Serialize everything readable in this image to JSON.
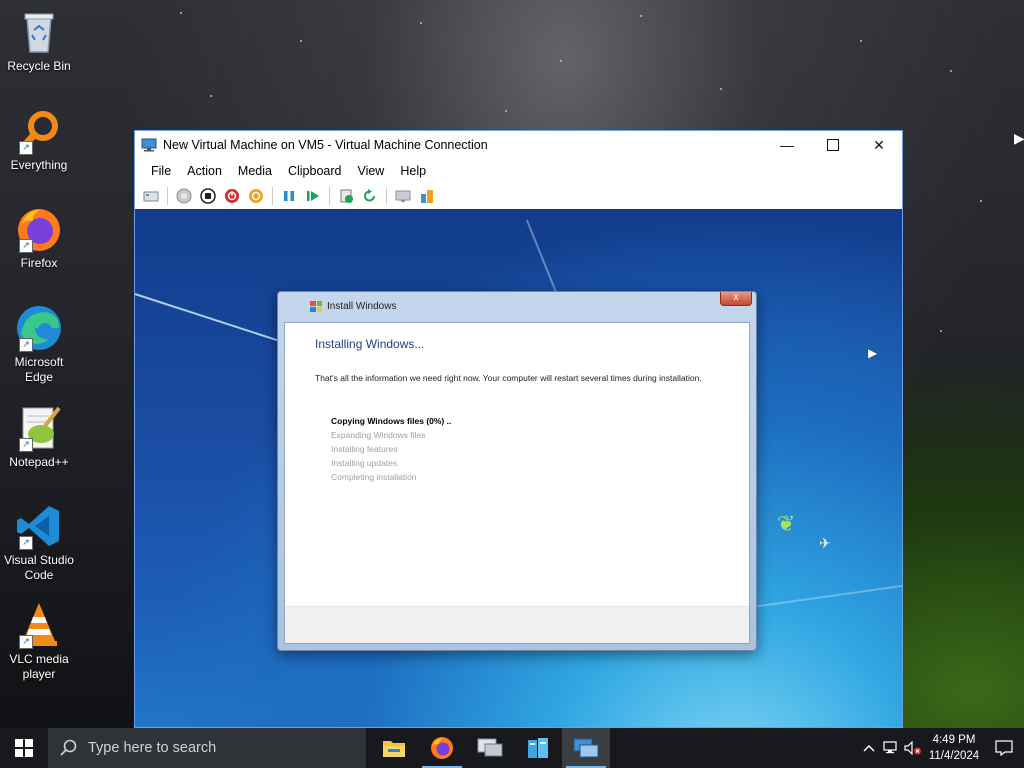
{
  "desktop": {
    "icons": [
      {
        "label": "Recycle Bin",
        "icon": "recycle-bin-icon"
      },
      {
        "label": "Everything",
        "icon": "everything-search-icon"
      },
      {
        "label": "Firefox",
        "icon": "firefox-icon"
      },
      {
        "label": "Microsoft Edge",
        "icon": "edge-icon"
      },
      {
        "label": "Notepad++",
        "icon": "notepad-plus-plus-icon"
      },
      {
        "label": "Visual Studio Code",
        "icon": "vscode-icon"
      },
      {
        "label": "VLC media player",
        "icon": "vlc-icon"
      }
    ]
  },
  "vm_window": {
    "title": "New Virtual Machine on VM5 - Virtual Machine Connection",
    "menu": [
      "File",
      "Action",
      "Media",
      "Clipboard",
      "View",
      "Help"
    ],
    "toolbar": [
      "ctrl-alt-del-icon",
      "start-icon",
      "turn-off-icon",
      "shut-down-icon",
      "save-icon",
      "pause-icon",
      "resume-icon",
      "checkpoint-icon",
      "revert-icon",
      "enhanced-session-icon",
      "share-icon"
    ]
  },
  "install_dialog": {
    "title": "Install Windows",
    "heading": "Installing Windows...",
    "description": "That's all the information we need right now. Your computer will restart several times during installation.",
    "steps": [
      {
        "label": "Copying Windows files (0%) ..",
        "active": true
      },
      {
        "label": "Expanding Windows files",
        "active": false
      },
      {
        "label": "Installing features",
        "active": false
      },
      {
        "label": "Installing updates",
        "active": false
      },
      {
        "label": "Completing installation",
        "active": false
      }
    ],
    "close_label": "x"
  },
  "taskbar": {
    "search_placeholder": "Type here to search",
    "apps": [
      "file-explorer-icon",
      "firefox-icon",
      "remote-desktop-icon",
      "server-manager-icon",
      "hyper-v-manager-icon"
    ],
    "clock_time": "4:49 PM",
    "clock_date": "11/4/2024"
  },
  "colors": {
    "accent": "#76b9ed",
    "dialog_heading": "#1e3f8a",
    "taskbar": "#17191c"
  }
}
